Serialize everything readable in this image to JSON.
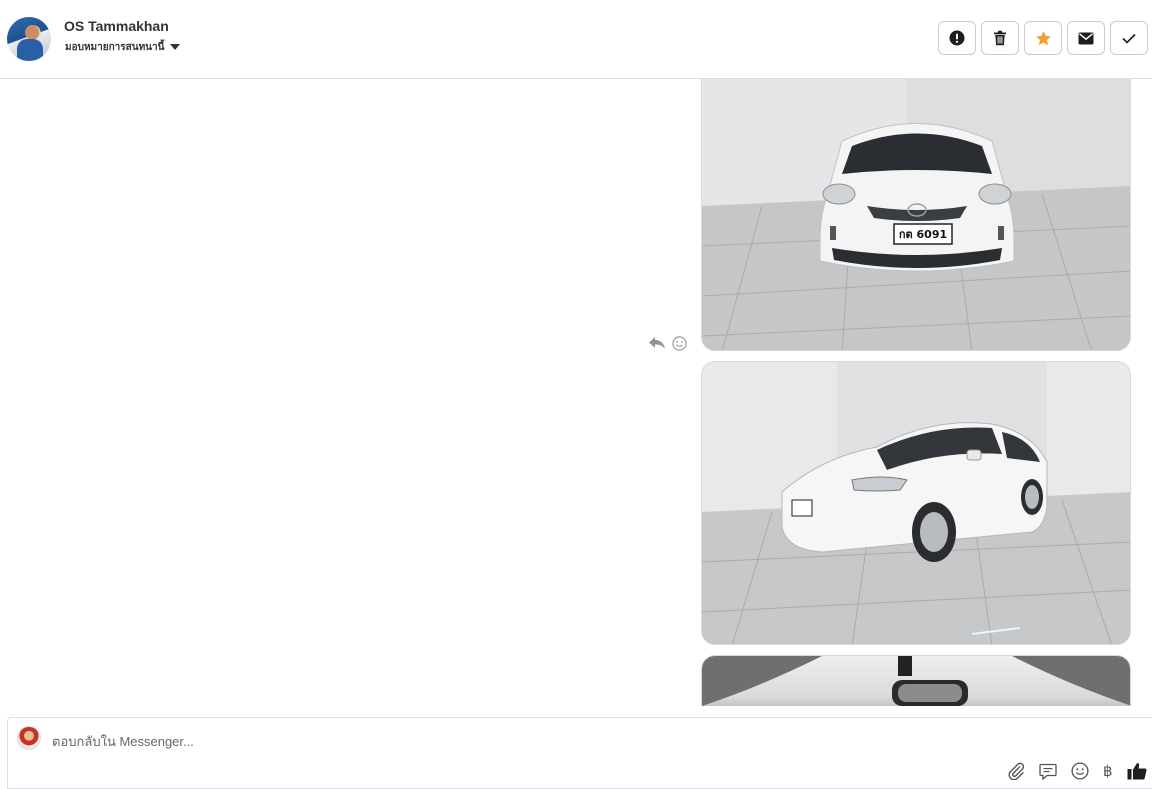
{
  "header": {
    "user_name": "OS Tammakhan",
    "assign_label": "มอบหมายการสนทนานี้",
    "actions": [
      {
        "name": "exclamation-icon"
      },
      {
        "name": "trash-icon"
      },
      {
        "name": "star-icon",
        "color": "#f0a030"
      },
      {
        "name": "envelope-icon"
      },
      {
        "name": "checkmark-icon"
      }
    ]
  },
  "thread": {
    "images": [
      {
        "plate": "กต 6091"
      },
      {
        "plate": ""
      },
      {
        "plate": ""
      }
    ]
  },
  "composer": {
    "placeholder": "ตอบกลับใน Messenger...",
    "tools": [
      "paperclip-icon",
      "speech-bubble-icon",
      "smiley-icon",
      "baht-icon",
      "thumbs-up-icon"
    ],
    "currency_symbol": "฿"
  },
  "colors": {
    "border": "#dddfe2",
    "star": "#f0a030",
    "icon": "#555555"
  }
}
